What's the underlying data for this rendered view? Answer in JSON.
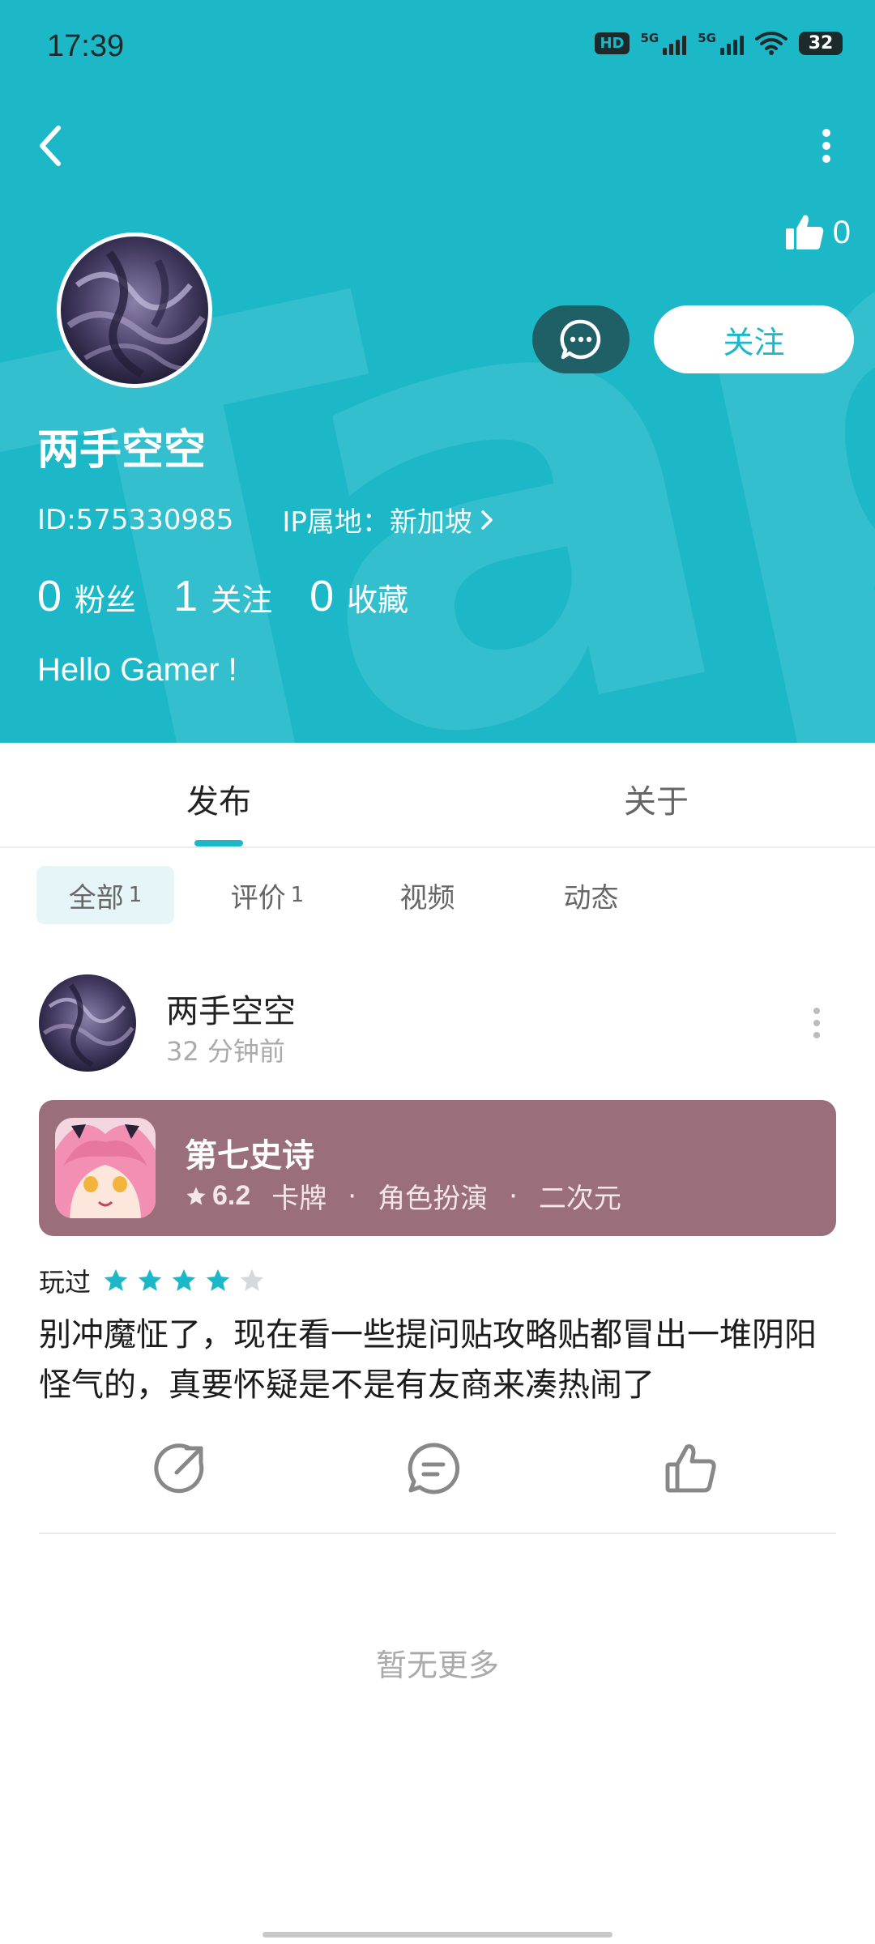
{
  "status_bar": {
    "time": "17:39",
    "hd_badge": "HD",
    "sim1_label": "5G",
    "sim2_label": "5G",
    "battery": "32",
    "icons": [
      "hd-voice-icon",
      "signal-5g-icon",
      "signal-5g-icon",
      "wifi-icon",
      "battery-icon"
    ]
  },
  "header": {
    "watermark": "TapTap",
    "like_count": "0",
    "follow_label": "关注",
    "username": "两手空空",
    "id_text": "ID:575330985",
    "ip_text": "IP属地：新加坡",
    "stats": [
      {
        "num": "0",
        "label": "粉丝"
      },
      {
        "num": "1",
        "label": "关注"
      },
      {
        "num": "0",
        "label": "收藏"
      }
    ],
    "bio": "Hello Gamer !",
    "colors": {
      "brand": "#1cb8c8",
      "chat_button": "#1f5f66"
    }
  },
  "tabs": [
    {
      "label": "发布",
      "active": true
    },
    {
      "label": "关于",
      "active": false
    }
  ],
  "subtabs": [
    {
      "label": "全部",
      "count": "1",
      "active": true
    },
    {
      "label": "评价",
      "count": "1",
      "active": false
    },
    {
      "label": "视频",
      "count": "",
      "active": false
    },
    {
      "label": "动态",
      "count": "",
      "active": false
    }
  ],
  "post": {
    "author": "两手空空",
    "time": "32 分钟前",
    "game": {
      "name": "第七史诗",
      "score": "6.2",
      "tags": [
        "卡牌",
        "角色扮演",
        "二次元"
      ],
      "separator": "·",
      "card_color": "#9a6e7b"
    },
    "played_label": "玩过",
    "rating": 4,
    "rating_max": 5,
    "text": "别冲魔怔了，现在看一些提问贴攻略贴都冒出一堆阴阳怪气的，真要怀疑是不是有友商来凑热闹了"
  },
  "footer": {
    "no_more": "暂无更多"
  }
}
